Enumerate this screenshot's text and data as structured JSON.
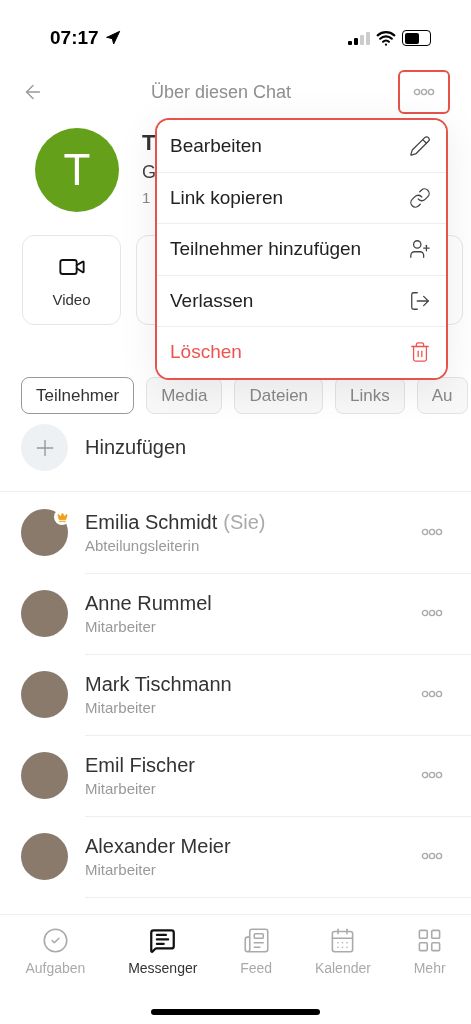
{
  "status_bar": {
    "time": "07:17"
  },
  "header": {
    "title": "Über diesen Chat"
  },
  "chat": {
    "avatar_letter": "T",
    "title": "T",
    "subtitle": "G",
    "meta": "1"
  },
  "actions": [
    {
      "label": "Video"
    }
  ],
  "menu": [
    {
      "label": "Bearbeiten",
      "kind": "edit"
    },
    {
      "label": "Link kopieren",
      "kind": "link"
    },
    {
      "label": "Teilnehmer hinzufügen",
      "kind": "add-user"
    },
    {
      "label": "Verlassen",
      "kind": "leave"
    },
    {
      "label": "Löschen",
      "kind": "delete"
    }
  ],
  "tabs": [
    {
      "label": "Teilnehmer",
      "selected": true
    },
    {
      "label": "Media",
      "selected": false
    },
    {
      "label": "Dateien",
      "selected": false
    },
    {
      "label": "Links",
      "selected": false
    },
    {
      "label": "Au",
      "selected": false
    }
  ],
  "add_row": {
    "label": "Hinzufügen"
  },
  "members": [
    {
      "name": "Emilia Schmidt",
      "suffix": "(Sie)",
      "role": "Abteilungsleiterin",
      "admin": true
    },
    {
      "name": "Anne Rummel",
      "role": "Mitarbeiter",
      "admin": false
    },
    {
      "name": "Mark Tischmann",
      "role": "Mitarbeiter",
      "admin": false
    },
    {
      "name": "Emil Fischer",
      "role": "Mitarbeiter",
      "admin": false
    },
    {
      "name": "Alexander Meier",
      "role": "Mitarbeiter",
      "admin": false
    }
  ],
  "tab_bar": [
    {
      "label": "Aufgaben",
      "kind": "tasks",
      "selected": false
    },
    {
      "label": "Messenger",
      "kind": "messenger",
      "selected": true
    },
    {
      "label": "Feed",
      "kind": "feed",
      "selected": false
    },
    {
      "label": "Kalender",
      "kind": "calendar",
      "selected": false
    },
    {
      "label": "Mehr",
      "kind": "more",
      "selected": false
    }
  ]
}
